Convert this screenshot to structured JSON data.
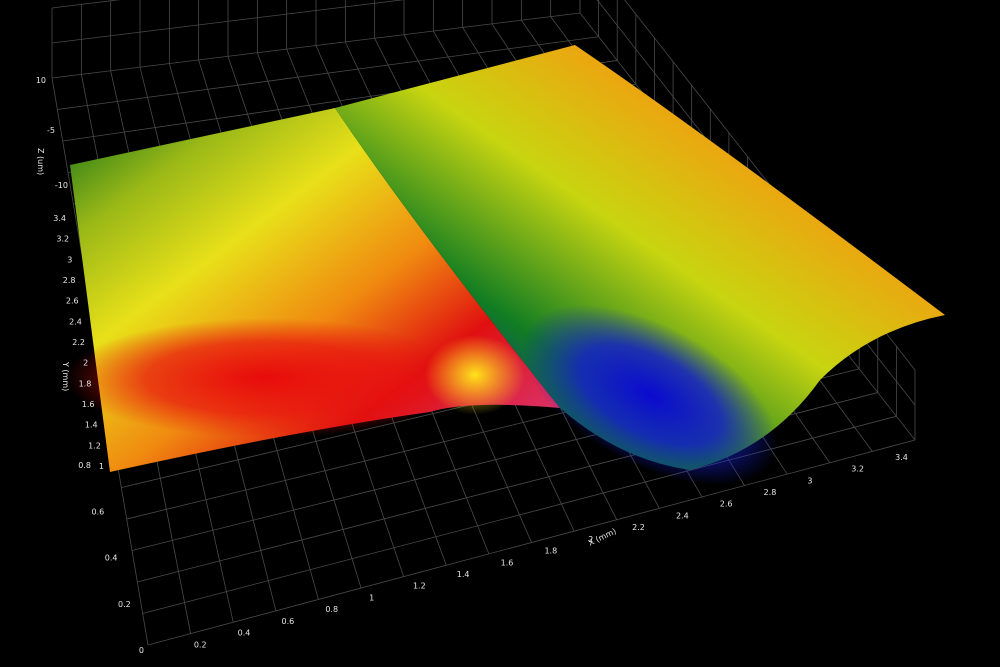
{
  "chart_data": {
    "type": "surface",
    "title": "",
    "xlabel": "X (mm)",
    "ylabel": "Y (mm)",
    "zlabel": "Z (um)",
    "xlim": [
      0,
      3.5
    ],
    "ylim": [
      0,
      3.5
    ],
    "zlim": [
      -10,
      10
    ],
    "x_ticks": [
      "0.2",
      "0.4",
      "0.6",
      "0.8",
      "1",
      "1.2",
      "1.4",
      "1.6",
      "1.8",
      "2",
      "2.2",
      "2.4",
      "2.6",
      "2.8",
      "3",
      "3.2",
      "3.4"
    ],
    "y_ticks": [
      "0",
      "0.2",
      "0.4",
      "0.6",
      "0.8",
      "1",
      "1.2",
      "1.4",
      "1.6",
      "1.8",
      "2",
      "2.2",
      "2.4",
      "2.6",
      "2.8",
      "3",
      "3.2",
      "3.4"
    ],
    "z_ticks": [
      "10",
      "-5",
      "-10"
    ],
    "colormap": [
      "#0000ff",
      "#008000",
      "#ffff00",
      "#ff0000",
      "#e0409a"
    ],
    "background": "#000000",
    "grid": true
  }
}
